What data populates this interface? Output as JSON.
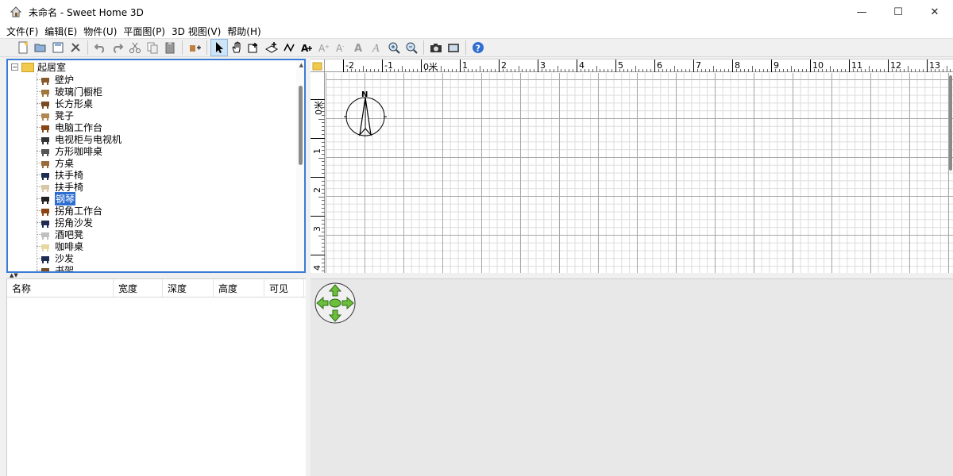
{
  "window": {
    "title": "未命名 - Sweet Home 3D",
    "controls": [
      "—",
      "☐",
      "✕"
    ]
  },
  "menu": [
    "文件(F)",
    "编辑(E)",
    "物件(U)",
    "平面图(P)",
    "3D 视图(V)",
    "帮助(H)"
  ],
  "toolbar": {
    "icons": [
      "new-home-icon",
      "open-icon",
      "save-icon",
      "preferences-icon",
      "undo-icon",
      "redo-icon",
      "cut-icon",
      "copy-icon",
      "paste-icon",
      "add-furniture-icon",
      "select-icon",
      "pan-icon",
      "create-walls-icon",
      "create-rooms-icon",
      "create-polylines-icon",
      "add-text-icon",
      "increase-text-icon",
      "decrease-text-icon",
      "bold-text-icon",
      "italic-text-icon",
      "zoom-in-icon",
      "zoom-out-icon",
      "create-photo-icon",
      "create-video-icon",
      "help-icon"
    ]
  },
  "catalog": {
    "root": "起居室",
    "items": [
      {
        "label": "壁炉",
        "icon": "fireplace-icon",
        "color": "#8b5a2b"
      },
      {
        "label": "玻璃门橱柜",
        "icon": "glass-cabinet-icon",
        "color": "#a0783c"
      },
      {
        "label": "长方形桌",
        "icon": "rectangular-table-icon",
        "color": "#7a4a22"
      },
      {
        "label": "凳子",
        "icon": "stool-icon",
        "color": "#b08850"
      },
      {
        "label": "电脑工作台",
        "icon": "computer-desk-icon",
        "color": "#8b4513"
      },
      {
        "label": "电视柜与电视机",
        "icon": "tv-cabinet-icon",
        "color": "#333333"
      },
      {
        "label": "方形咖啡桌",
        "icon": "square-coffee-table-icon",
        "color": "#555555"
      },
      {
        "label": "方桌",
        "icon": "square-table-icon",
        "color": "#9a6a3a"
      },
      {
        "label": "扶手椅",
        "icon": "armchair-dark-icon",
        "color": "#1f2d55"
      },
      {
        "label": "扶手椅",
        "icon": "armchair-light-icon",
        "color": "#d8c8a8"
      },
      {
        "label": "钢琴",
        "icon": "piano-icon",
        "color": "#222222",
        "selected": true
      },
      {
        "label": "拐角工作台",
        "icon": "corner-desk-icon",
        "color": "#8b4513"
      },
      {
        "label": "拐角沙发",
        "icon": "corner-sofa-icon",
        "color": "#1f2d55"
      },
      {
        "label": "酒吧凳",
        "icon": "bar-stool-icon",
        "color": "#c0c0c0"
      },
      {
        "label": "咖啡桌",
        "icon": "coffee-table-icon",
        "color": "#e8d8a0"
      },
      {
        "label": "沙发",
        "icon": "sofa-icon",
        "color": "#1f2d55"
      },
      {
        "label": "书架",
        "icon": "bookshelf-icon",
        "color": "#7a4a22"
      }
    ]
  },
  "table": {
    "columns": [
      "名称",
      "宽度",
      "深度",
      "高度",
      "可见"
    ]
  },
  "plan": {
    "ruler_x": [
      "-2",
      "-1",
      "0米",
      "1",
      "2",
      "3",
      "4",
      "5",
      "6",
      "7",
      "8",
      "9",
      "10",
      "11",
      "12",
      "13"
    ],
    "ruler_y": [
      "0米",
      "1",
      "2",
      "3",
      "4"
    ],
    "compass_label": "N"
  },
  "colors": {
    "accent": "#3a7bd5",
    "selection": "#2f6ed1",
    "nav_green": "#6cbf3a"
  }
}
